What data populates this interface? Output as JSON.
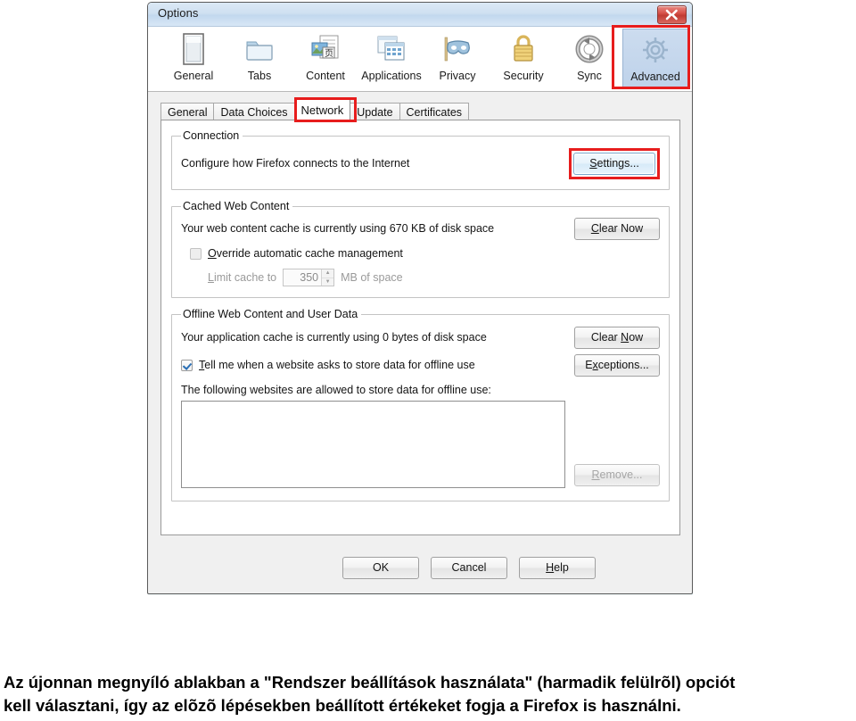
{
  "window": {
    "title": "Options",
    "close_icon": "close-x-icon"
  },
  "toolbar": {
    "items": [
      {
        "label": "General",
        "icon": "general-window-icon",
        "selected": false
      },
      {
        "label": "Tabs",
        "icon": "tabs-folder-icon",
        "selected": false
      },
      {
        "label": "Content",
        "icon": "content-page-icon",
        "selected": false
      },
      {
        "label": "Applications",
        "icon": "applications-icon",
        "selected": false
      },
      {
        "label": "Privacy",
        "icon": "privacy-mask-icon",
        "selected": false
      },
      {
        "label": "Security",
        "icon": "security-padlock-icon",
        "selected": false
      },
      {
        "label": "Sync",
        "icon": "sync-arrows-icon",
        "selected": false
      },
      {
        "label": "Advanced",
        "icon": "advanced-gear-icon",
        "selected": true
      }
    ]
  },
  "tabs": {
    "items": [
      {
        "label": "General",
        "active": false
      },
      {
        "label": "Data Choices",
        "active": false
      },
      {
        "label": "Network",
        "active": true
      },
      {
        "label": "Update",
        "active": false
      },
      {
        "label": "Certificates",
        "active": false
      }
    ]
  },
  "connection": {
    "legend": "Connection",
    "description": "Configure how Firefox connects to the Internet",
    "settings_button": "Settings..."
  },
  "cached_web_content": {
    "legend": "Cached Web Content",
    "usage_text": "Your web content cache is currently using 670 KB of disk space",
    "clear_button": "Clear Now",
    "override_label": "Override automatic cache management",
    "override_checked": false,
    "limit_label": "Limit cache to",
    "limit_value": "350",
    "limit_units": "MB of space"
  },
  "offline_content": {
    "legend": "Offline Web Content and User Data",
    "usage_text": "Your application cache is currently using 0 bytes of disk space",
    "clear_button": "Clear Now",
    "exceptions_button": "Exceptions...",
    "tell_me_label": "Tell me when a website asks to store data for offline use",
    "tell_me_checked": true,
    "list_label": "The following websites are allowed to store data for offline use:",
    "list_items": [],
    "remove_button": "Remove..."
  },
  "dialog_buttons": {
    "ok": "OK",
    "cancel": "Cancel",
    "help": "Help"
  },
  "caption": {
    "line1": "Az újonnan megnyíló ablakban a \"Rendszer beállítások használata\" (harmadik felülrõl) opciót",
    "line2": "kell választani, így az elõzõ lépésekben beállított értékeket fogja a Firefox is használni."
  },
  "colors": {
    "highlight_red": "#e71d1d",
    "titlebar_blue": "#cfe0f1",
    "selected_tab_blue": "#c4d6ea",
    "close_red": "#c03b32",
    "check_blue": "#2a6fb5"
  }
}
